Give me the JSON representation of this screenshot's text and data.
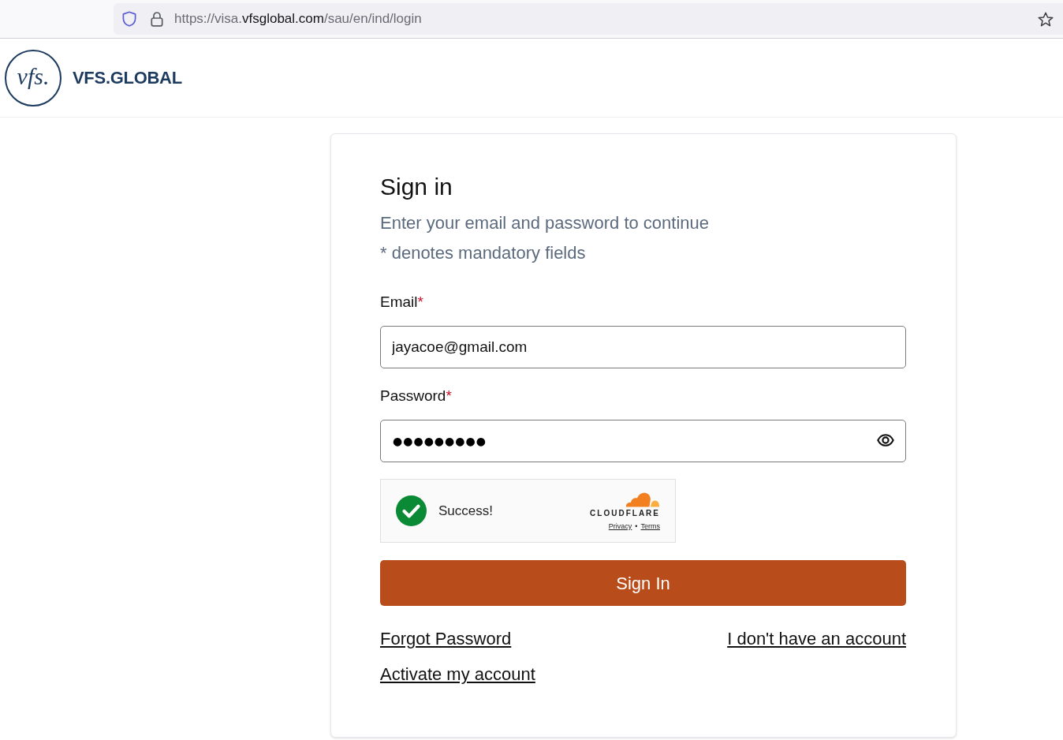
{
  "browser": {
    "url": {
      "prefix": "https://visa.",
      "domain": "vfsglobal.com",
      "path": "/sau/en/ind/login"
    }
  },
  "header": {
    "logo_mark": "vfs.",
    "logo_text": "VFS.GLOBAL"
  },
  "sign_in_card": {
    "title": "Sign in",
    "subtitle": "Enter your email and password to continue",
    "mandatory_note": "* denotes mandatory fields",
    "fields": [
      {
        "kind": "text",
        "label": "Email",
        "required_mark": "*",
        "value": "jayacoe@gmail.com"
      },
      {
        "kind": "password",
        "label": "Password",
        "required_mark": "*",
        "value": "●●●●●●●●●"
      }
    ],
    "captcha": {
      "verified": true,
      "status": "Success!",
      "provider": "CLOUDFLARE",
      "links": [
        "Privacy",
        "Terms"
      ],
      "separator": "•"
    },
    "submit_button": "Sign In",
    "link_rows": [
      [
        "Forgot Password",
        "I don't have an account"
      ],
      [
        "Activate my account"
      ]
    ]
  }
}
